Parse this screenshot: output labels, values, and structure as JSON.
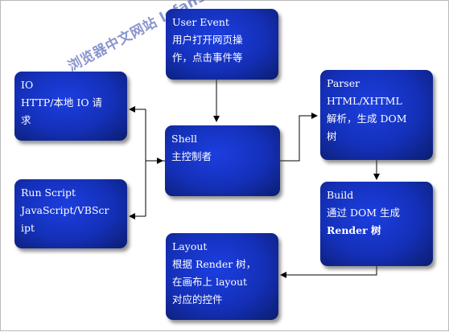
{
  "watermark": "浏览器中文网站 lefans.net",
  "nodes": {
    "user_event": {
      "lines": [
        "User Event",
        "用户打开网页操",
        "作，点击事件等"
      ]
    },
    "io": {
      "lines": [
        "IO",
        "HTTP/本地 IO 请",
        "求"
      ]
    },
    "parser": {
      "lines": [
        "Parser",
        "HTML/XHTML",
        "解析，生成 DOM",
        "树"
      ]
    },
    "shell": {
      "lines": [
        "Shell",
        "主控制者"
      ]
    },
    "run_script": {
      "lines": [
        "Run Script",
        "JavaScript/VBScr",
        "ipt"
      ]
    },
    "build": {
      "lines": [
        "Build",
        "通过  DOM  生成",
        "Render 树"
      ]
    },
    "layout": {
      "lines": [
        "Layout",
        "根据 Render 树，",
        "在画布上  layout",
        "对应的控件"
      ]
    }
  },
  "colors": {
    "node_fill": "#1430b8",
    "arrow": "#000000",
    "text": "#ffffff"
  }
}
